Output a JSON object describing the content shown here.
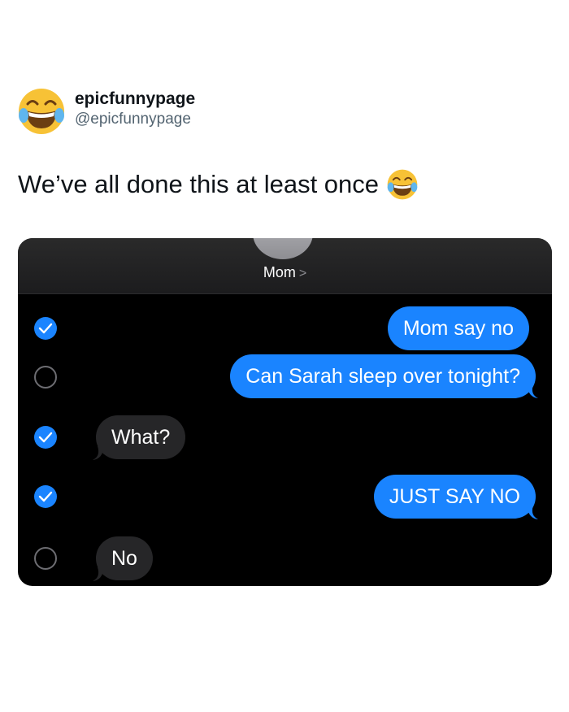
{
  "post": {
    "display_name": "epicfunnypage",
    "handle": "@epicfunnypage",
    "text": "We’ve all done this at least once"
  },
  "avatar_icon": "face-with-tears-of-joy",
  "colors": {
    "imessage_blue": "#1a84ff",
    "received_gray": "#262628",
    "background": "#000000"
  },
  "conversation": {
    "contact": "Mom",
    "messages": [
      {
        "text": "Mom say no",
        "direction": "outgoing",
        "selected": true
      },
      {
        "text": "Can Sarah sleep over tonight?",
        "direction": "outgoing",
        "selected": false
      },
      {
        "text": "What?",
        "direction": "incoming",
        "selected": true
      },
      {
        "text": "JUST SAY NO",
        "direction": "outgoing",
        "selected": true
      },
      {
        "text": "No",
        "direction": "incoming",
        "selected": false
      }
    ]
  }
}
